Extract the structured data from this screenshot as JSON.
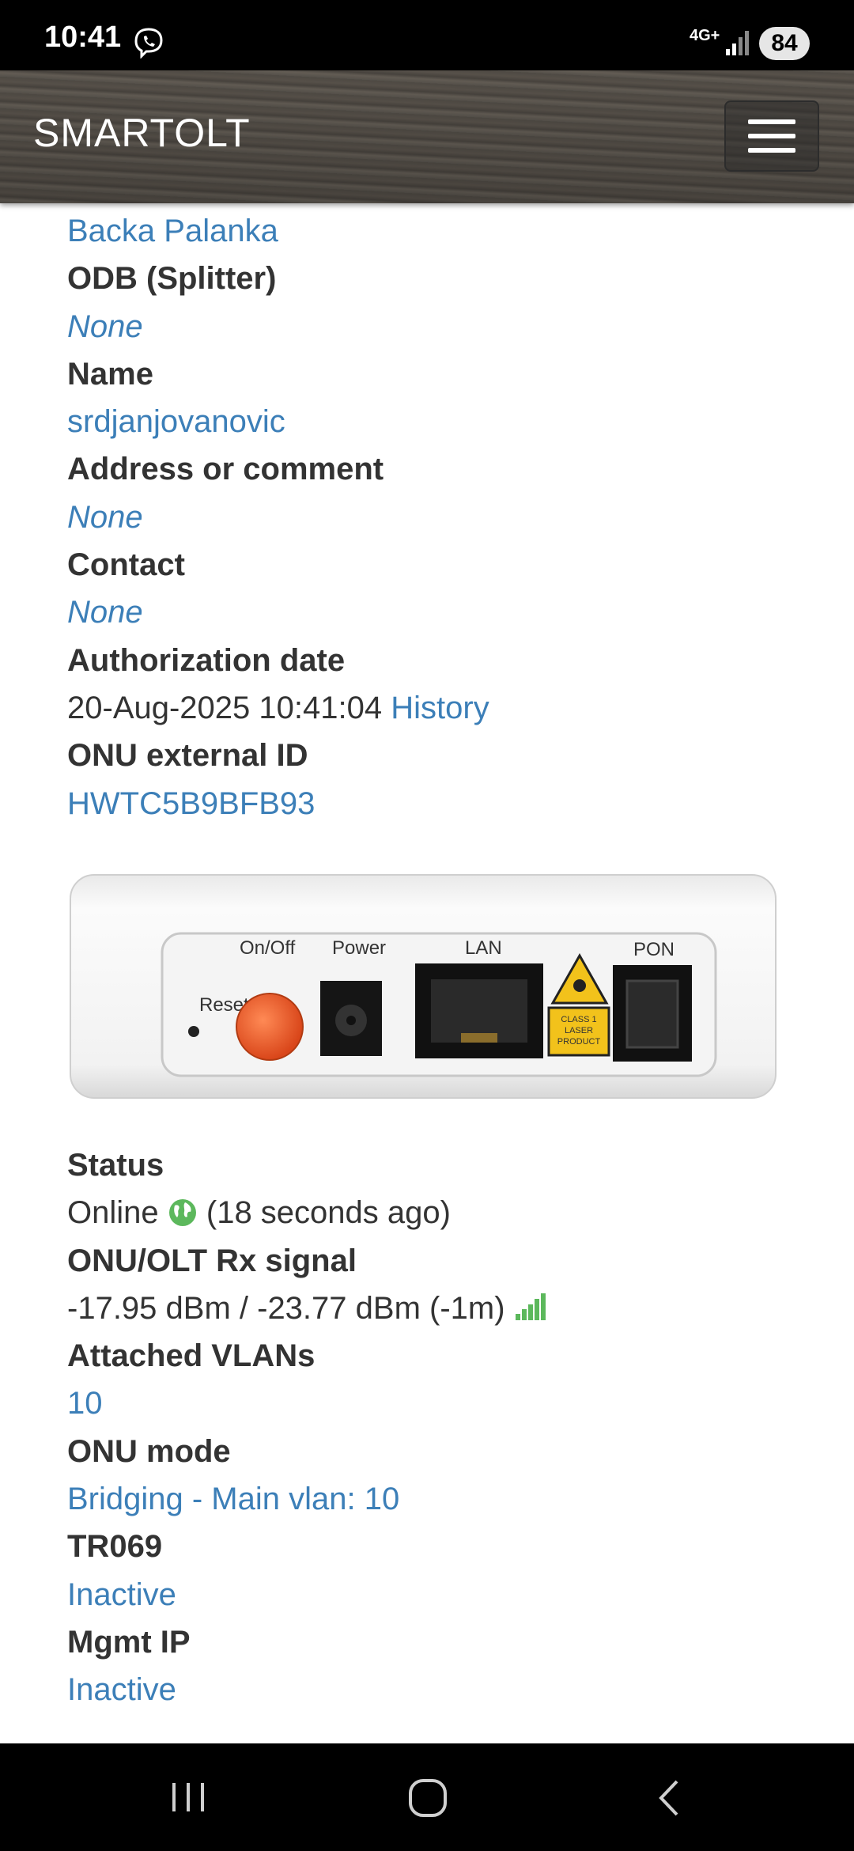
{
  "status_bar": {
    "time": "10:41",
    "network": "4G+",
    "battery": "84",
    "icons": [
      "viber-icon",
      "signal-icon"
    ]
  },
  "navbar": {
    "brand": "SMARTOLT",
    "menu_icon": "hamburger-icon"
  },
  "details_top": [
    {
      "value": "Backa Palanka"
    },
    {
      "label": "ODB (Splitter)",
      "value": "None"
    },
    {
      "label": "Name",
      "value": "srdjanjovanovic"
    },
    {
      "label": "Address or comment",
      "value": "None"
    },
    {
      "label": "Contact",
      "value": "None"
    },
    {
      "label": "Authorization date",
      "value": "20-Aug-2025 10:41:04",
      "link": "History"
    },
    {
      "label": "ONU external ID",
      "value": "HWTC5B9BFB93"
    }
  ],
  "device_image": {
    "labels": [
      "On/Off",
      "Power",
      "LAN",
      "PON",
      "Reset"
    ],
    "laser_label": [
      "CLASS 1",
      "LASER",
      "PRODUCT"
    ],
    "colors": {
      "body": "#f3f3f3",
      "button": "#f2662a",
      "laser": "#f2c21b"
    }
  },
  "details_bottom": {
    "status": {
      "label": "Status",
      "value": "Online",
      "suffix": "(18 seconds ago)",
      "icon": "globe-icon"
    },
    "signal": {
      "label": "ONU/OLT Rx signal",
      "value": "-17.95 dBm / -23.77 dBm (-1m)",
      "icon": "signal-bars-icon"
    },
    "vlans": {
      "label": "Attached VLANs",
      "value": "10"
    },
    "mode": {
      "label": "ONU mode",
      "value": "Bridging - Main vlan: 10"
    },
    "tr069": {
      "label": "TR069",
      "value": "Inactive"
    },
    "mgmt": {
      "label": "Mgmt IP",
      "value": "Inactive"
    }
  },
  "colors": {
    "link": "#3c7fb8",
    "label": "#333333",
    "online": "#5cb85c"
  }
}
